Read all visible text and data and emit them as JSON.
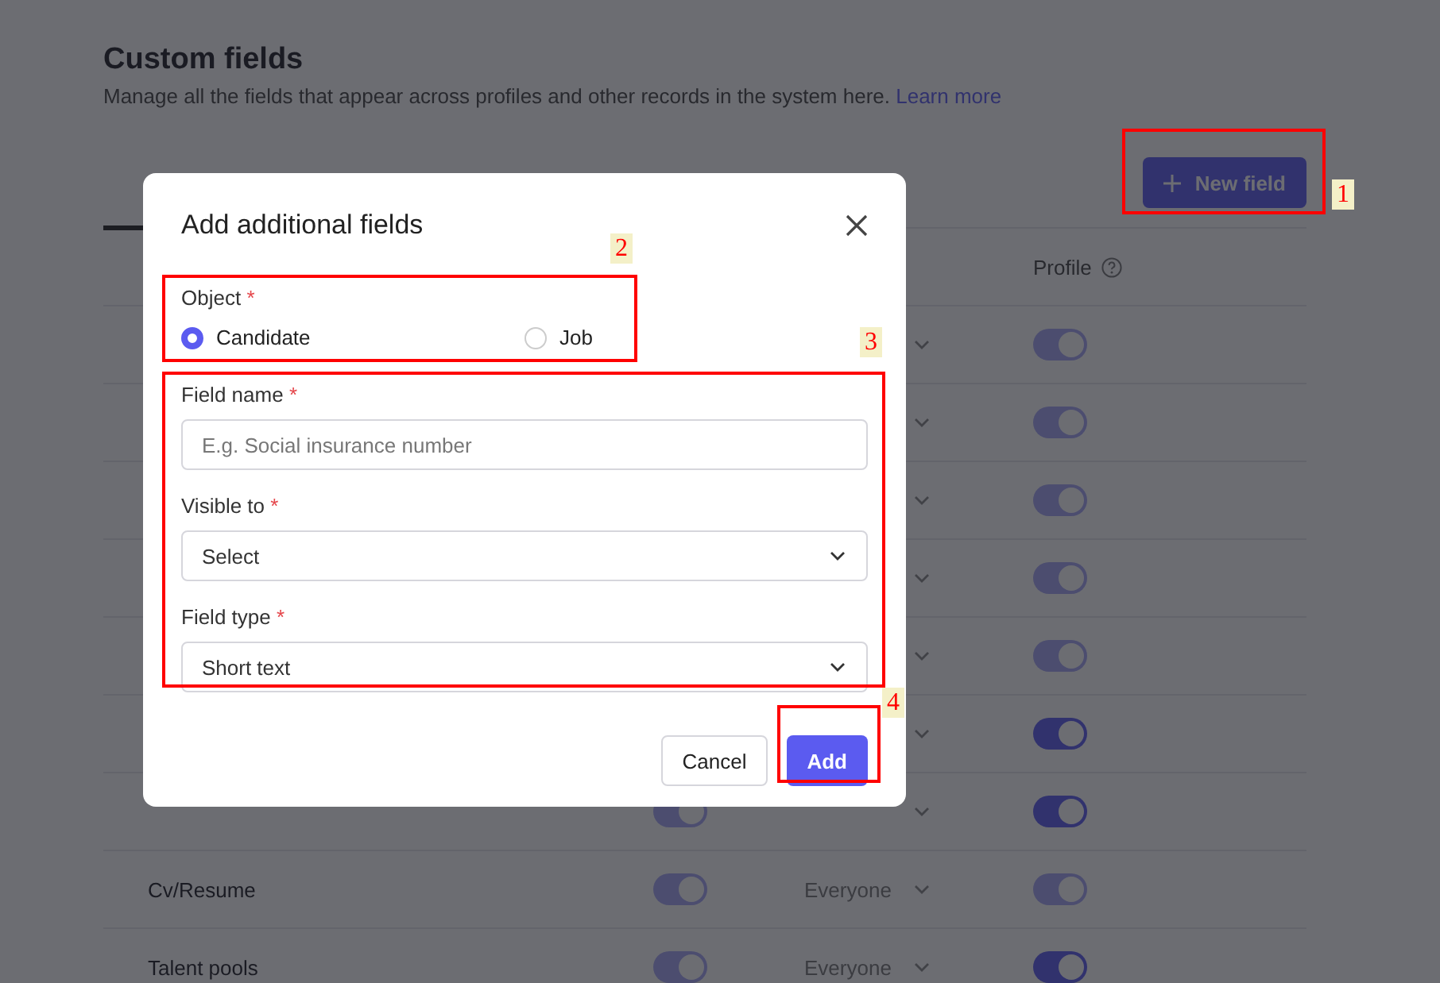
{
  "page": {
    "title": "Custom fields",
    "description": "Manage all the fields that appear across profiles and other records in the system here.",
    "learn_more": "Learn more",
    "new_field_button": "New field"
  },
  "table": {
    "columns": [
      {
        "label": "Profile",
        "help": true
      }
    ],
    "rows": [
      {
        "profile": {
          "on": true,
          "disabled": true
        }
      },
      {
        "profile": {
          "on": true,
          "disabled": true
        }
      },
      {
        "profile": {
          "on": true,
          "disabled": true
        }
      },
      {
        "profile": {
          "on": true,
          "disabled": true
        }
      },
      {
        "profile": {
          "on": true,
          "disabled": true
        }
      },
      {
        "profile": {
          "on": true,
          "disabled": false
        }
      },
      {
        "column_2": {
          "on": true,
          "disabled": true
        },
        "profile": {
          "on": true,
          "disabled": false
        }
      },
      {
        "name": "Cv/Resume",
        "column_2": {
          "on": true,
          "disabled": true
        },
        "visible_to": "Everyone",
        "profile": {
          "on": true,
          "disabled": true
        }
      },
      {
        "name": "Talent pools",
        "column_2": {
          "on": true,
          "disabled": true
        },
        "visible_to": "Everyone",
        "profile": {
          "on": true,
          "disabled": false
        }
      }
    ]
  },
  "dialog": {
    "title": "Add additional fields",
    "object": {
      "label": "Object",
      "required_mark": "*",
      "options": [
        {
          "label": "Candidate",
          "selected": true
        },
        {
          "label": "Job",
          "selected": false
        }
      ]
    },
    "fields": [
      {
        "kind": "text",
        "label": "Field name",
        "required_mark": "*",
        "placeholder": "E.g. Social insurance number"
      },
      {
        "kind": "select",
        "label": "Visible to",
        "required_mark": "*",
        "value": "Select"
      },
      {
        "kind": "select",
        "label": "Field type",
        "required_mark": "*",
        "value": "Short text"
      }
    ],
    "buttons": [
      {
        "label": "Cancel",
        "kind": "secondary"
      },
      {
        "label": "Add",
        "kind": "primary"
      }
    ]
  },
  "annotations": [
    {
      "label": "1"
    },
    {
      "label": "2"
    },
    {
      "label": "3"
    },
    {
      "label": "4"
    }
  ]
}
